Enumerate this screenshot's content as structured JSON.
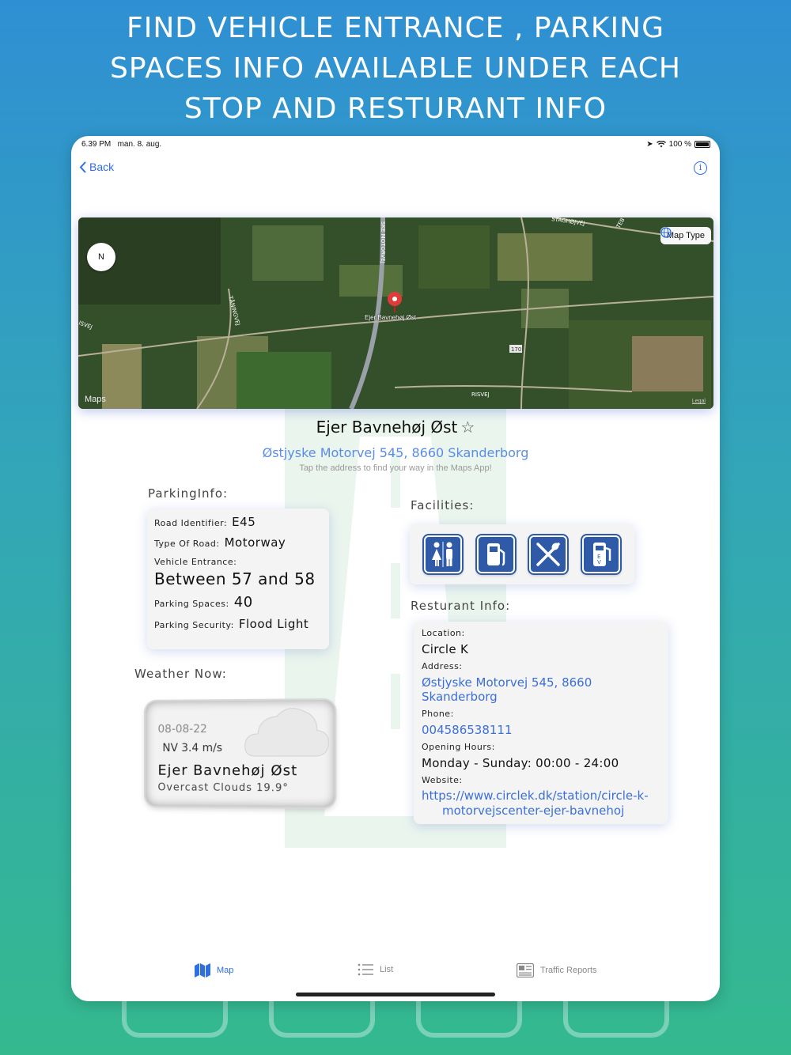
{
  "promo": {
    "line1": "FIND VEHICLE ENTRANCE , PARKING",
    "line2": "SPACES INFO AVAILABLE UNDER EACH",
    "line3": "STOP AND RESTURANT INFO"
  },
  "status_bar": {
    "time": "6.39 PM",
    "date": "man. 8. aug.",
    "battery": "100 %"
  },
  "nav": {
    "back_label": "Back",
    "info_glyph": "i"
  },
  "map": {
    "compass_label": "N",
    "map_type_label": "Map Type",
    "pin_label": "Ejer Bavnehøj Øst",
    "maps_logo": "Maps",
    "legal": "Legal",
    "road_labels": [
      "SKE MOTORVEJ",
      "TÅNINGVEJ",
      "ISVEJ",
      "STAGHØJVEJ",
      "TEB",
      "RISVEJ",
      "170"
    ]
  },
  "place": {
    "title": "Ejer Bavnehøj Øst",
    "star": "☆",
    "address": "Østjyske Motorvej 545, 8660 Skanderborg",
    "hint": "Tap the address to find your way in the Maps App!"
  },
  "parking": {
    "section_label": "ParkingInfo:",
    "road_identifier_key": "Road Identifier:",
    "road_identifier_val": "E45",
    "type_of_road_key": "Type Of Road:",
    "type_of_road_val": "Motorway",
    "vehicle_entrance_key": "Vehicle Entrance:",
    "vehicle_entrance_val": "Between 57 and 58",
    "parking_spaces_key": "Parking Spaces:",
    "parking_spaces_val": "40",
    "parking_security_key": "Parking Security:",
    "parking_security_val": "Flood Light"
  },
  "facilities": {
    "section_label": "Facilities:",
    "icons": [
      "restroom-icon",
      "fuel-pump-icon",
      "restaurant-icon",
      "ev-charger-icon"
    ]
  },
  "restaurant": {
    "section_label": "Resturant Info:",
    "location_key": "Location:",
    "location_val": "Circle K",
    "address_key": "Address:",
    "address_val": "Østjyske Motorvej 545, 8660 Skanderborg",
    "phone_key": "Phone:",
    "phone_val": "004586538111",
    "hours_key": "Opening Hours:",
    "hours_val": "Monday - Sunday: 00:00 - 24:00",
    "website_key": "Website:",
    "website_line1": "https://www.circlek.dk/station/circle-k-",
    "website_line2": "motorvejscenter-ejer-bavnehoj"
  },
  "weather": {
    "section_label": "Weather Now:",
    "date": "08-08-22",
    "wind": "NV 3.4 m/s",
    "place": "Ejer Bavnehøj Øst",
    "description": "Overcast Clouds 19.9°"
  },
  "tabs": {
    "map": "Map",
    "list": "List",
    "traffic": "Traffic Reports"
  },
  "colors": {
    "accent": "#2f6fe0",
    "link": "#3a6fd8",
    "facility_icon_bg": "#2e5aa8"
  }
}
